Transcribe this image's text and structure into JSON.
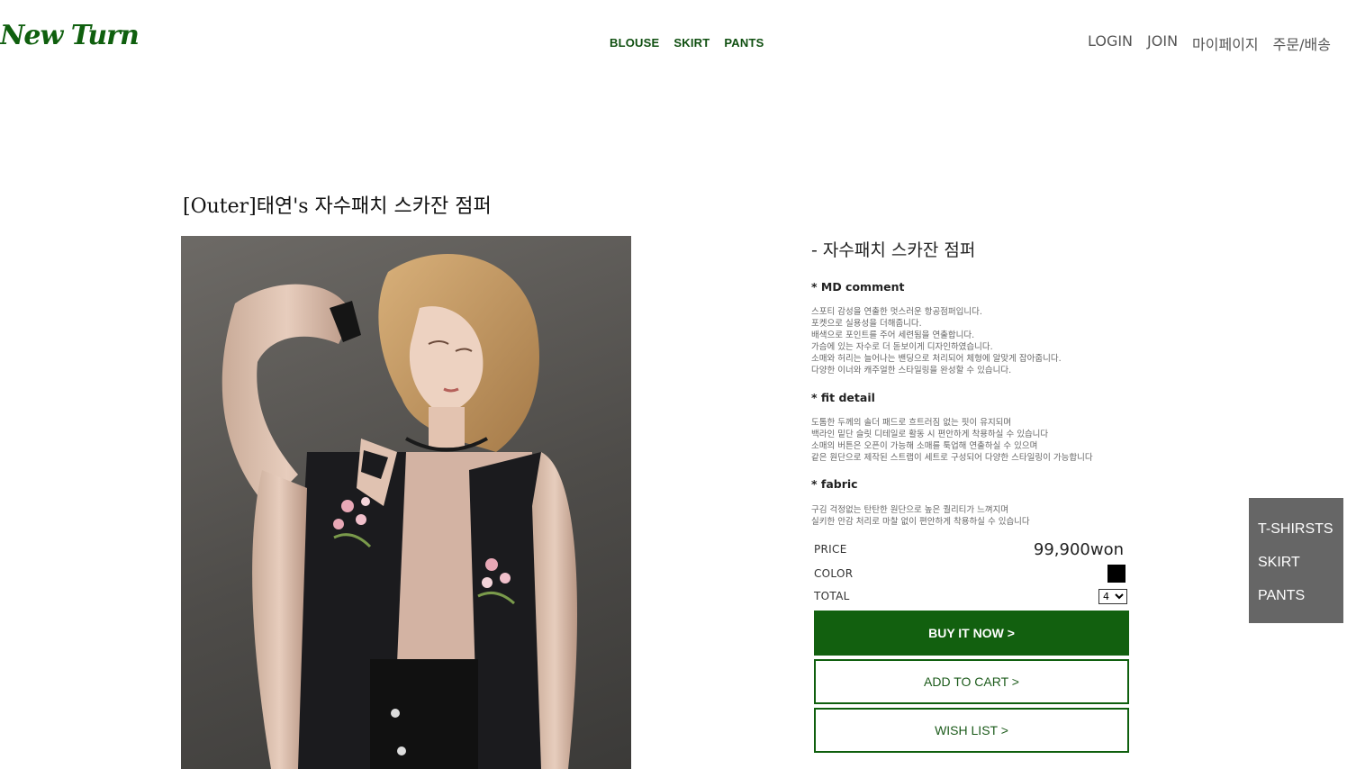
{
  "brand": {
    "logo_text": "New Turn"
  },
  "main_nav": [
    "BLOUSE",
    "SKIRT",
    "PANTS"
  ],
  "user_nav": [
    "LOGIN",
    "JOIN",
    "마이페이지",
    "주문/배송"
  ],
  "product": {
    "title": "[Outer]태연's 자수패치 스카잔 점퍼",
    "subtitle": "- 자수패치 스카잔 점퍼",
    "md_comment": {
      "heading": "* MD comment",
      "lines": [
        "스포티 감성을 연출한 멋스러운 항공점퍼입니다.",
        "포켓으로 실용성을 더해줍니다.",
        "배색으로 포인트를 주어 세련됨을 연출합니다.",
        "가슴에 있는 자수로 더 돋보이게 디자인하였습니다.",
        "소매와 허리는 늘어나는 밴딩으로 처리되어 체형에 알맞게 잡아줍니다.",
        "다양한 이너와 캐주얼한 스타일링을 완성할 수 있습니다."
      ]
    },
    "fit_detail": {
      "heading": "* fit detail",
      "lines": [
        "도톰한 두께의 솔더 패드로 흐트러짐 없는 핏이 유지되며",
        "백라인 밑단 슬릿 디테일로 활동 시 편안하게 착용하실 수 있습니다",
        "소매의 버튼은 오픈이 가능해 소매를 툭업해 연출하실 수 있으며",
        "같은 원단으로 제작된 스트랩이 세트로 구성되어 다양한 스타일링이 가능합니다"
      ]
    },
    "fabric": {
      "heading": "* fabric",
      "lines": [
        "구김 걱정없는 탄탄한 원단으로 높은 퀄리티가 느껴지며",
        "실키한 안감 처리로 마찰 없이 편안하게 착용하실 수 있습니다"
      ]
    },
    "price_label": "PRICE",
    "price_value": "99,900won",
    "color_label": "COLOR",
    "color_swatch": "#000000",
    "total_label": "TOTAL",
    "total_value": "4"
  },
  "buttons": {
    "buy": "BUY IT NOW >",
    "cart": "ADD TO CART >",
    "wish": "WISH LIST >"
  },
  "side_menu": [
    "T-SHIRSTS",
    "SKIRT",
    "PANTS"
  ],
  "colors": {
    "brand_green": "#12600f",
    "side_menu_bg": "#666666"
  }
}
